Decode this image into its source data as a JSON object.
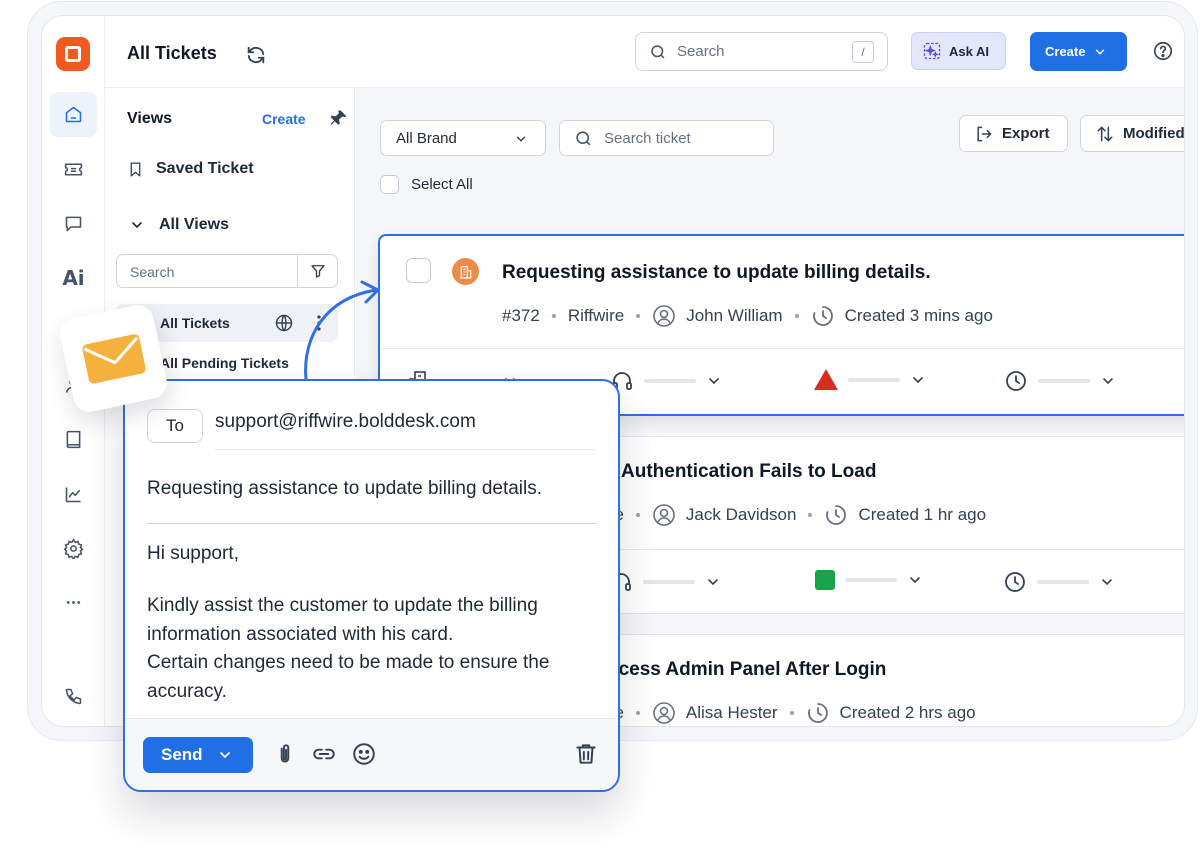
{
  "header": {
    "title": "All Tickets",
    "search_placeholder": "Search",
    "search_shortcut": "/",
    "ask_ai_label": "Ask AI",
    "create_label": "Create"
  },
  "rail": {
    "items": [
      "home-icon",
      "ticket-icon",
      "chat-icon",
      "ai-icon",
      "calendar-icon",
      "contacts-icon",
      "book-icon",
      "analytics-icon",
      "settings-icon",
      "more-icon",
      "phone-icon"
    ],
    "ai_text": "Ai"
  },
  "views": {
    "title": "Views",
    "create_label": "Create",
    "saved_label": "Saved Ticket",
    "all_views_label": "All Views",
    "search_placeholder": "Search",
    "items": [
      {
        "label": "All Tickets",
        "active": true
      },
      {
        "label": "All Pending Tickets",
        "active": false
      }
    ]
  },
  "toolbar": {
    "brand_select": "All Brand",
    "ticket_search_placeholder": "Search ticket",
    "select_all_label": "Select All",
    "export_label": "Export",
    "sort_label": "Modified"
  },
  "tickets": [
    {
      "title": "Requesting assistance to update billing details.",
      "id": "#372",
      "brand": "Riffwire",
      "agent": "John William",
      "created": "Created 3 mins ago",
      "priority_color": "#d92d20"
    },
    {
      "title": "Authentication Fails to Load",
      "brand": "ire",
      "agent": "Jack Davidson",
      "created": "Created 1 hr ago",
      "priority_color": "#16a34a"
    },
    {
      "title": "ccess Admin Panel After Login",
      "brand": "ire",
      "agent": "Alisa Hester",
      "created": "Created 2 hrs ago"
    }
  ],
  "composer": {
    "to_label": "To",
    "to_address": "support@riffwire.bolddesk.com",
    "subject": "Requesting assistance to update billing details.",
    "greeting": "Hi support,",
    "body_line1": "Kindly assist the customer to update the billing information associated with his card.",
    "body_line2": "Certain changes need to be made to ensure the accuracy.",
    "send_label": "Send"
  },
  "colors": {
    "accent": "#1f6fe5",
    "brand_logo": "#f05a22",
    "mail_icon": "#f5b13d"
  }
}
